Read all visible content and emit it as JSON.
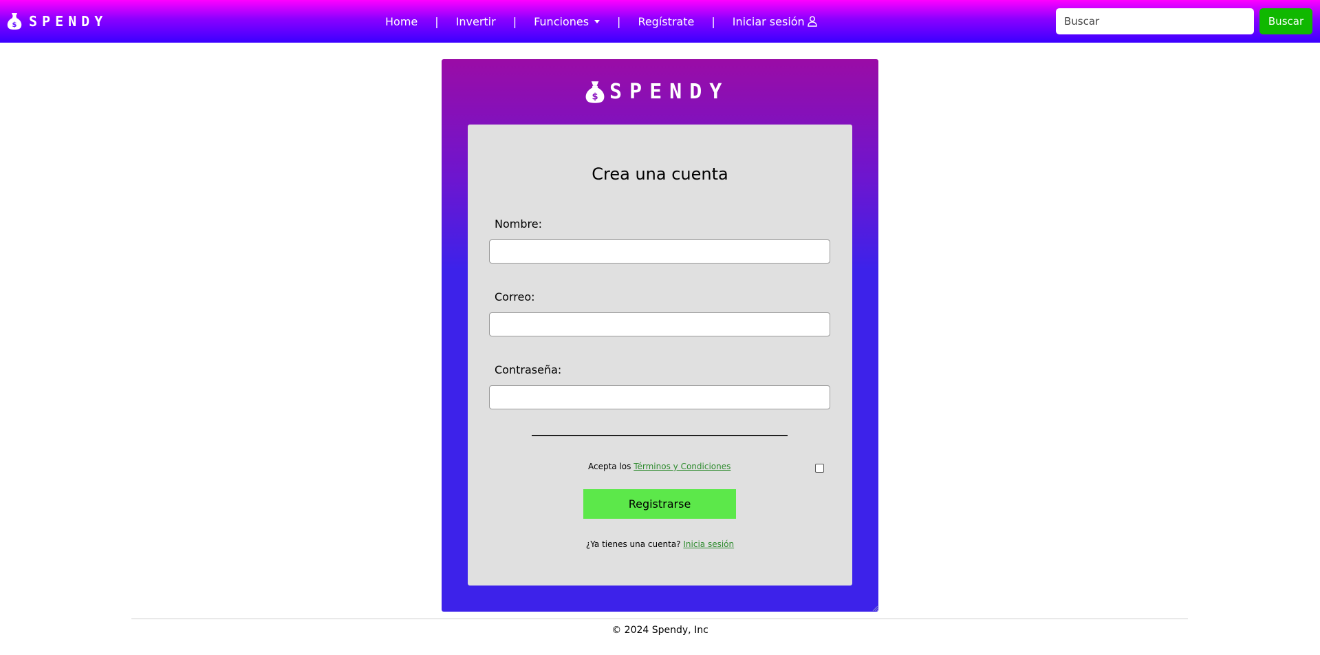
{
  "navbar": {
    "brand": "SPENDY",
    "links": [
      {
        "label": "Home"
      },
      {
        "label": "Invertir"
      },
      {
        "label": "Funciones"
      },
      {
        "label": "Regístrate"
      },
      {
        "label": "Iniciar sesión"
      }
    ],
    "separator": "|",
    "search": {
      "placeholder": "Buscar",
      "value": ""
    },
    "search_button": "Buscar"
  },
  "panel": {
    "brand": "SPENDY",
    "title": "Crea una cuenta",
    "fields": [
      {
        "label": "Nombre:",
        "value": ""
      },
      {
        "label": "Correo:",
        "value": ""
      },
      {
        "label": "Contraseña:",
        "value": ""
      }
    ],
    "terms_prefix": "Acepta los ",
    "terms_link": "Términos y Condiciones",
    "terms_checked": false,
    "register_button": "Registrarse",
    "login_prompt": "¿Ya tienes una cuenta? ",
    "login_link": "Inicia sesión"
  },
  "footer": {
    "text": "© 2024 Spendy, Inc"
  },
  "colors": {
    "nav_top": "#ff00ff",
    "nav_bottom": "#3a00ff",
    "search_button": "#10b800",
    "register_button": "#5ce84a",
    "card": "#e0e0e0",
    "link": "#2e8b2e"
  }
}
